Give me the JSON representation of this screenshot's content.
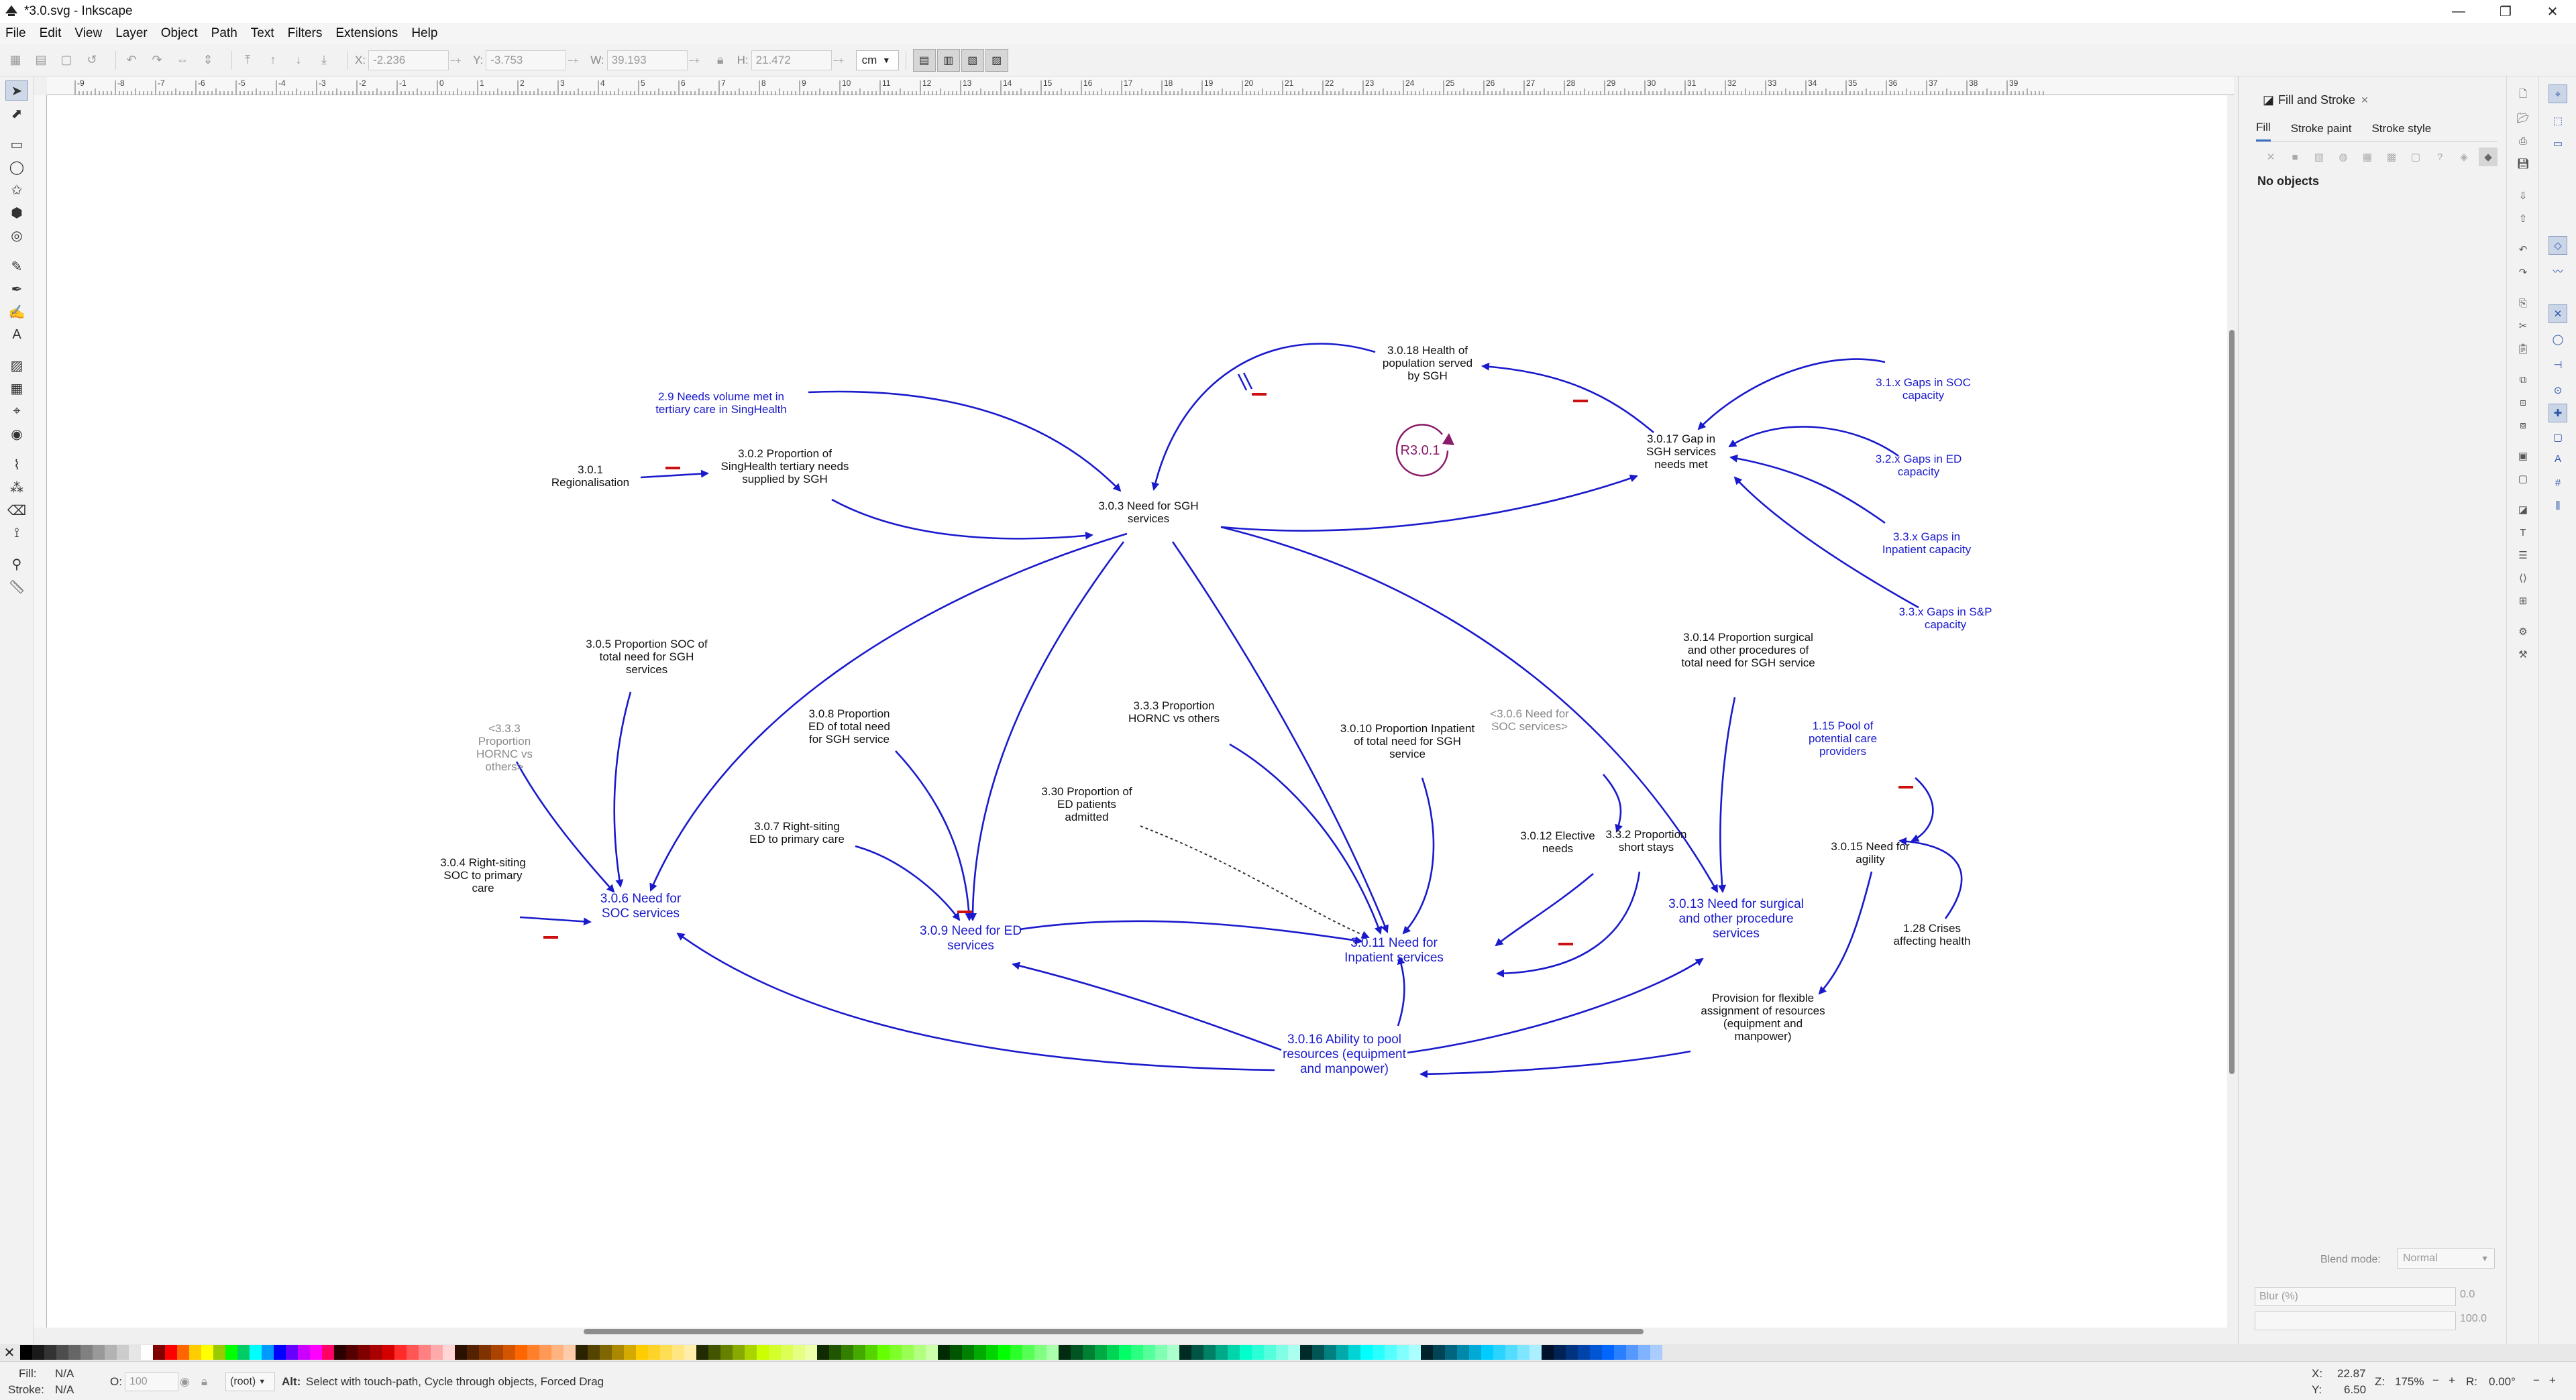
{
  "window": {
    "title": "*3.0.svg - Inkscape",
    "minimize": "—",
    "maximize": "❐",
    "close": "✕"
  },
  "menu": [
    "File",
    "Edit",
    "View",
    "Layer",
    "Object",
    "Path",
    "Text",
    "Filters",
    "Extensions",
    "Help"
  ],
  "toolbar": {
    "x_label": "X:",
    "x_value": "-2.236",
    "y_label": "Y:",
    "y_value": "-3.753",
    "w_label": "W:",
    "w_value": "39.193",
    "h_label": "H:",
    "h_value": "21.472",
    "unit": "cm"
  },
  "ruler": {
    "labels": [
      "-9",
      "-8",
      "-7",
      "-6",
      "-5",
      "-4",
      "-3",
      "-2",
      "-1",
      "0",
      "1",
      "2",
      "3",
      "4",
      "5",
      "6",
      "7",
      "8",
      "9",
      "10",
      "11",
      "12",
      "13",
      "14",
      "15",
      "16",
      "17",
      "18",
      "19",
      "20",
      "21",
      "22",
      "23",
      "24",
      "25",
      "26",
      "27",
      "28",
      "29",
      "30",
      "31",
      "32",
      "33",
      "34",
      "35",
      "36",
      "37",
      "38",
      "39"
    ]
  },
  "diagram": {
    "nodes": [
      {
        "id": "n2_9",
        "lines": [
          "2.9 Needs volume met in",
          "tertiary care in SingHealth"
        ],
        "color": "#1a1acc"
      },
      {
        "id": "n3_0_1",
        "lines": [
          "3.0.1",
          "Regionalisation"
        ],
        "color": "#111111"
      },
      {
        "id": "n3_0_2",
        "lines": [
          "3.0.2 Proportion of",
          "SingHealth tertiary needs",
          "supplied by SGH"
        ],
        "color": "#111111"
      },
      {
        "id": "n3_0_3",
        "lines": [
          "3.0.3 Need for SGH",
          "services"
        ],
        "color": "#111111"
      },
      {
        "id": "n3_0_18",
        "lines": [
          "3.0.18 Health of",
          "population served",
          "by SGH"
        ],
        "color": "#111111"
      },
      {
        "id": "nR3",
        "lines": [
          "R3.0.1"
        ],
        "color": "#8a1a6a"
      },
      {
        "id": "n3_0_17",
        "lines": [
          "3.0.17 Gap in",
          "SGH services",
          "needs met"
        ],
        "color": "#111111"
      },
      {
        "id": "n3_1x",
        "lines": [
          "3.1.x Gaps in SOC",
          "capacity"
        ],
        "color": "#1a1acc"
      },
      {
        "id": "n3_2x",
        "lines": [
          "3.2.x Gaps in ED",
          "capacity"
        ],
        "color": "#1a1acc"
      },
      {
        "id": "n3_3x_inp",
        "lines": [
          "3.3.x Gaps in",
          "Inpatient capacity"
        ],
        "color": "#1a1acc"
      },
      {
        "id": "n3_3x_sp",
        "lines": [
          "3.3.x Gaps in S&P",
          "capacity"
        ],
        "color": "#1a1acc"
      },
      {
        "id": "n3_0_5",
        "lines": [
          "3.0.5 Proportion SOC of",
          "total need for SGH",
          "services"
        ],
        "color": "#111111"
      },
      {
        "id": "n3_3_3_ghost",
        "lines": [
          "<3.3.3",
          "Proportion",
          "HORNC vs",
          "others>"
        ],
        "color": "#8a8a8a"
      },
      {
        "id": "n3_0_8",
        "lines": [
          "3.0.8 Proportion",
          "ED of total need",
          "for SGH service"
        ],
        "color": "#111111"
      },
      {
        "id": "n3_3_3",
        "lines": [
          "3.3.3 Proportion",
          "HORNC vs others"
        ],
        "color": "#111111"
      },
      {
        "id": "n3_0_10",
        "lines": [
          "3.0.10 Proportion Inpatient",
          "of total need for SGH",
          "service"
        ],
        "color": "#111111"
      },
      {
        "id": "n3_0_6_ghost",
        "lines": [
          "<3.0.6 Need for",
          "SOC services>"
        ],
        "color": "#8a8a8a"
      },
      {
        "id": "n3_0_14",
        "lines": [
          "3.0.14 Proportion surgical",
          "and other procedures of",
          "total need for SGH service"
        ],
        "color": "#111111"
      },
      {
        "id": "n1_15",
        "lines": [
          "1.15 Pool of",
          "potential care",
          "providers"
        ],
        "color": "#1a1acc"
      },
      {
        "id": "n3_30",
        "lines": [
          "3.30 Proportion of",
          "ED patients",
          "admitted"
        ],
        "color": "#111111"
      },
      {
        "id": "n3_0_7",
        "lines": [
          "3.0.7 Right-siting",
          "ED to primary care"
        ],
        "color": "#111111"
      },
      {
        "id": "n3_0_4",
        "lines": [
          "3.0.4 Right-siting",
          "SOC to primary",
          "care"
        ],
        "color": "#111111"
      },
      {
        "id": "n3_0_6",
        "lines": [
          "3.0.6 Need for",
          "SOC services"
        ],
        "color": "#1a1acc"
      },
      {
        "id": "n3_0_9",
        "lines": [
          "3.0.9 Need for ED",
          "services"
        ],
        "color": "#1a1acc"
      },
      {
        "id": "n3_0_11",
        "lines": [
          "3.0.11 Need for",
          "Inpatient services"
        ],
        "color": "#1a1acc"
      },
      {
        "id": "n3_0_12",
        "lines": [
          "3.0.12 Elective",
          "needs"
        ],
        "color": "#111111"
      },
      {
        "id": "n3_3_2",
        "lines": [
          "3.3.2 Proportion",
          "short stays"
        ],
        "color": "#111111"
      },
      {
        "id": "n3_0_13",
        "lines": [
          "3.0.13 Need for surgical",
          "and other procedure",
          "services"
        ],
        "color": "#1a1acc"
      },
      {
        "id": "n3_0_15",
        "lines": [
          "3.0.15 Need for",
          "agility"
        ],
        "color": "#111111"
      },
      {
        "id": "n1_28",
        "lines": [
          "1.28 Crises",
          "affecting health"
        ],
        "color": "#111111"
      },
      {
        "id": "nProv",
        "lines": [
          "Provision for flexible",
          "assignment of resources",
          "(equipment and",
          "manpower)"
        ],
        "color": "#111111"
      },
      {
        "id": "n3_0_16",
        "lines": [
          "3.0.16 Ability to pool",
          "resources (equipment",
          "and manpower)"
        ],
        "color": "#1a1acc"
      }
    ]
  },
  "dock": {
    "panel_title": "Fill and Stroke",
    "tabs": [
      "Fill",
      "Stroke paint",
      "Stroke style"
    ],
    "no_objects": "No objects",
    "blend_label": "Blend mode:",
    "blend_value": "Normal",
    "blur_label": "Blur (%)",
    "blur_value": "0.0",
    "opacity_value": "100.0"
  },
  "status": {
    "fill_label": "Fill:",
    "fill_value": "N/A",
    "stroke_label": "Stroke:",
    "stroke_value": "N/A",
    "opacity_label": "O:",
    "opacity_value": "100",
    "layer": "(root)",
    "message_bold": "Alt:",
    "message": " Select with touch-path, Cycle through objects, Forced Drag",
    "x_label": "X:",
    "x_value": "22.87",
    "y_label": "Y:",
    "y_value": "6.50",
    "zoom_label": "Z:",
    "zoom_value": "175%",
    "rot_label": "R:",
    "rot_value": "0.00°"
  },
  "colors": {
    "link": "#1a1acc",
    "polarity": "#cc1010",
    "loop": "#8a1a6a",
    "ghost": "#8a8a8a"
  }
}
